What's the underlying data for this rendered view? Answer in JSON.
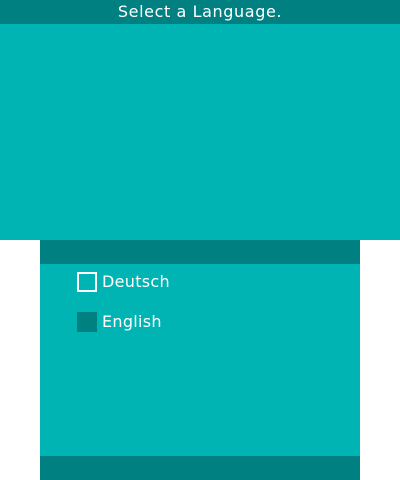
{
  "top_screen": {
    "header": {
      "title": "Select a Language."
    }
  },
  "bottom_screen": {
    "languages": [
      {
        "label": "Deutsch",
        "selected": false
      },
      {
        "label": "English",
        "selected": true
      }
    ]
  },
  "colors": {
    "screen_bg": "#00b4b4",
    "bar_bg": "#008080",
    "text": "#ffffff",
    "outer_bg": "#ffffff"
  }
}
